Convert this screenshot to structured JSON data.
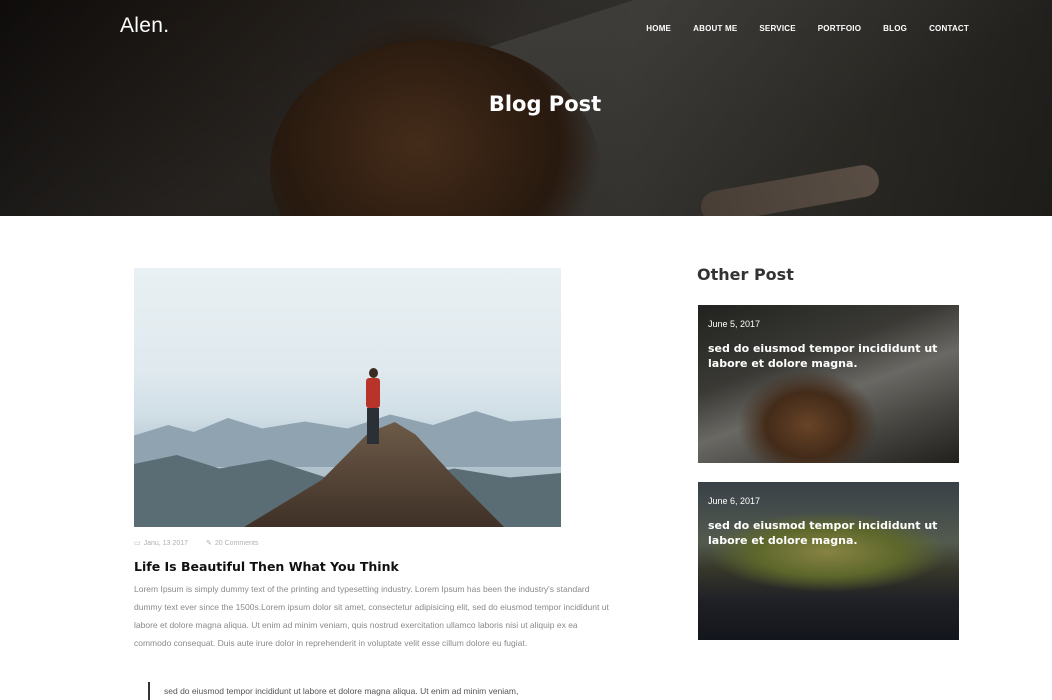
{
  "header": {
    "logo": "Alen.",
    "nav": [
      "HOME",
      "ABOUT ME",
      "SERVICE",
      "PORTFOIO",
      "BLOG",
      "CONTACT"
    ],
    "page_title": "Blog Post"
  },
  "post": {
    "date_icon": "calendar-icon",
    "date": "Janu, 13 2017",
    "comments_icon": "comment-icon",
    "comments": "20 Comments",
    "title": "Life Is Beautiful Then What You Think",
    "body": "Lorem Ipsum is simply dummy text of the printing and typesetting industry. Lorem Ipsum has been the industry's standard dummy text ever since the 1500s.Lorem ipsum dolor sit amet, consectetur adipisicing elit, sed do eiusmod tempor incididunt ut labore et dolore magna aliqua. Ut enim ad minim veniam, quis nostrud exercitation ullamco laboris nisi ut aliquip ex ea commodo consequat. Duis aute irure dolor in reprehenderit in voluptate velit esse cillum dolore eu fugiat.",
    "quote": "sed do eiusmod tempor incididunt ut labore et dolore magna aliqua. Ut enim ad minim veniam,"
  },
  "sidebar": {
    "title": "Other Post",
    "cards": [
      {
        "date": "June 5, 2017",
        "excerpt": "sed do eiusmod tempor incididunt ut labore et dolore magna."
      },
      {
        "date": "June 6, 2017",
        "excerpt": "sed do eiusmod tempor incididunt ut labore et dolore magna."
      }
    ]
  }
}
